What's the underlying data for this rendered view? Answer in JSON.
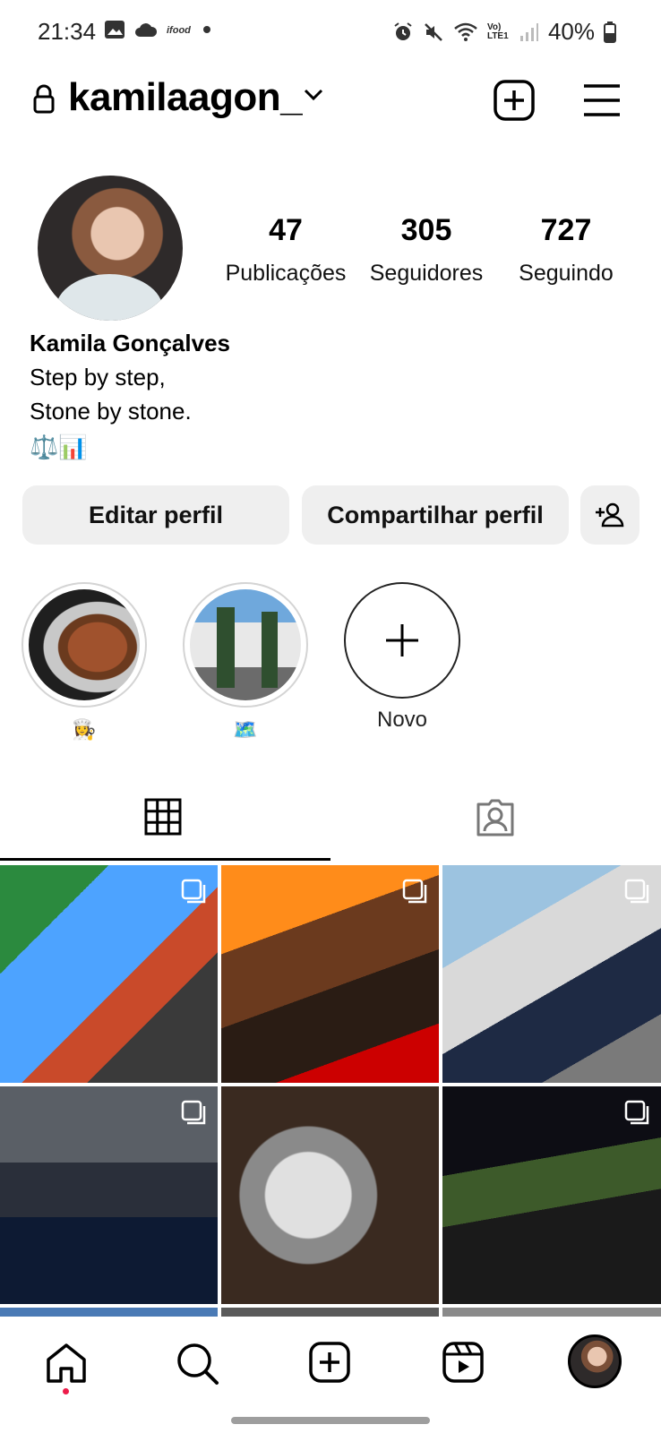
{
  "status_bar": {
    "time": "21:34",
    "battery": "40%",
    "network": "Vo) LTE1"
  },
  "header": {
    "username": "kamilaagon_"
  },
  "profile": {
    "posts_count": "47",
    "posts_label": "Publicações",
    "followers_count": "305",
    "followers_label": "Seguidores",
    "following_count": "727",
    "following_label": "Seguindo",
    "full_name": "Kamila Gonçalves",
    "bio_line1": "Step by step,",
    "bio_line2": "Stone by stone.",
    "bio_line3": "⚖️📊"
  },
  "buttons": {
    "edit": "Editar perfil",
    "share": "Compartilhar perfil"
  },
  "highlights": [
    {
      "label": "👩‍🍳"
    },
    {
      "label": "🗺️"
    }
  ],
  "new_highlight_label": "Novo",
  "colors": {
    "accent": "#ed1c4a",
    "button_bg": "#efefef"
  }
}
